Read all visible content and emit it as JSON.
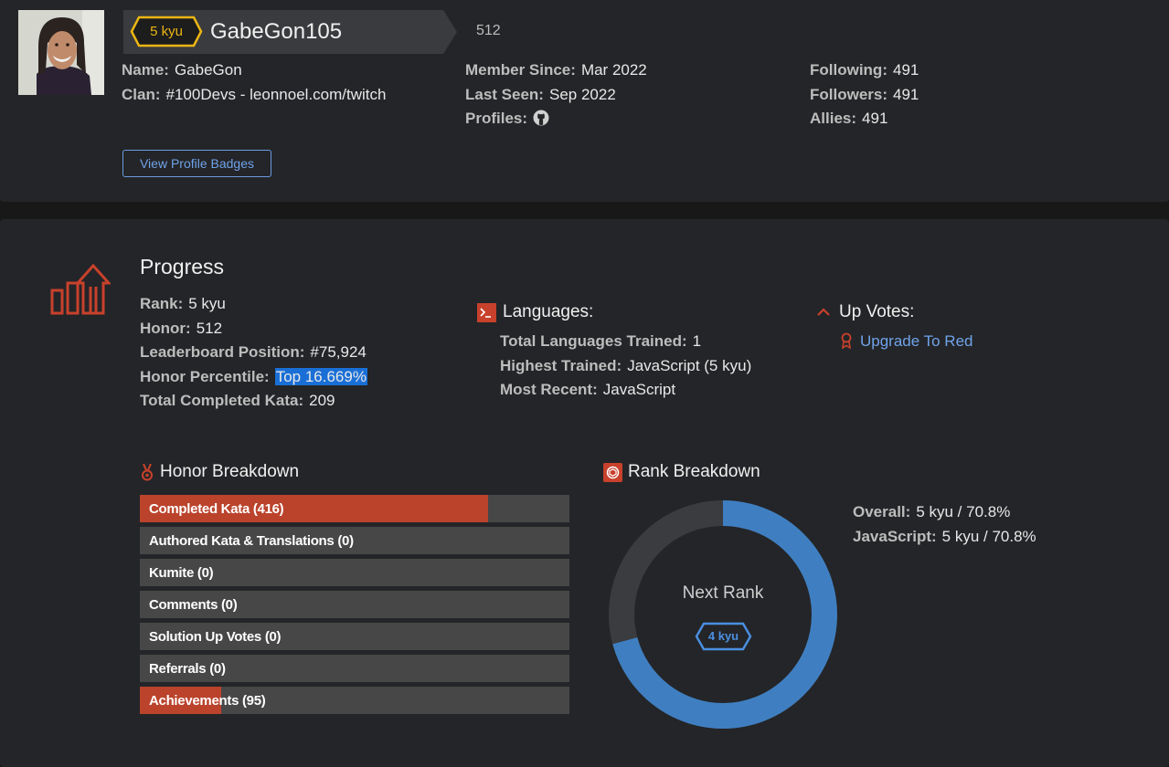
{
  "profile": {
    "rank_badge": "5 kyu",
    "username": "GabeGon105",
    "honor": "512",
    "name_label": "Name:",
    "name_value": "GabeGon",
    "clan_label": "Clan:",
    "clan_value": "#100Devs - leonnoel.com/twitch",
    "member_since_label": "Member Since:",
    "member_since_value": "Mar 2022",
    "last_seen_label": "Last Seen:",
    "last_seen_value": "Sep 2022",
    "profiles_label": "Profiles:",
    "profiles_icon": "github-icon",
    "following_label": "Following:",
    "following_value": "491",
    "followers_label": "Followers:",
    "followers_value": "491",
    "allies_label": "Allies:",
    "allies_value": "491",
    "badges_button": "View Profile Badges",
    "rank_color": "#ecb613"
  },
  "progress": {
    "title": "Progress",
    "rank_label": "Rank:",
    "rank_value": "5 kyu",
    "honor_label": "Honor:",
    "honor_value": "512",
    "leaderboard_label": "Leaderboard Position:",
    "leaderboard_value": "#75,924",
    "percentile_label": "Honor Percentile:",
    "percentile_value": "Top 16.669%",
    "completed_label": "Total Completed Kata:",
    "completed_value": "209"
  },
  "languages": {
    "title": "Languages:",
    "total_label": "Total Languages Trained:",
    "total_value": "1",
    "highest_label": "Highest Trained:",
    "highest_value": "JavaScript (5 kyu)",
    "recent_label": "Most Recent:",
    "recent_value": "JavaScript"
  },
  "upvotes": {
    "title": "Up Votes:",
    "link": "Upgrade To Red"
  },
  "honor_breakdown": {
    "title": "Honor Breakdown",
    "bars": [
      {
        "label": "Completed Kata (416)",
        "fraction": 0.81
      },
      {
        "label": "Authored Kata & Translations (0)",
        "fraction": 0
      },
      {
        "label": "Kumite (0)",
        "fraction": 0
      },
      {
        "label": "Comments (0)",
        "fraction": 0
      },
      {
        "label": "Solution Up Votes (0)",
        "fraction": 0
      },
      {
        "label": "Referrals (0)",
        "fraction": 0
      },
      {
        "label": "Achievements (95)",
        "fraction": 0.19
      }
    ],
    "fill_color": "#bb432c"
  },
  "rank_breakdown": {
    "title": "Rank Breakdown",
    "progress_fraction": 0.708,
    "next_rank_label": "Next Rank",
    "next_rank_badge": "4 kyu",
    "overall_label": "Overall:",
    "overall_value": "5 kyu / 70.8%",
    "javascript_label": "JavaScript:",
    "javascript_value": "5 kyu / 70.8%",
    "ring_color": "#3f7fc1"
  }
}
